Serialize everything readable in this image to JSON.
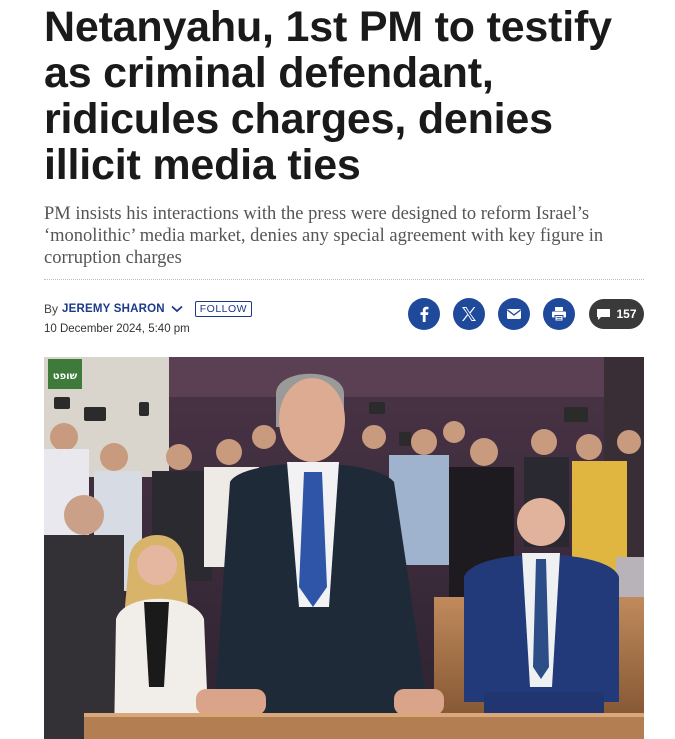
{
  "article": {
    "headline": "Netanyahu, 1st PM to testify as criminal defendant, ridicules charges, denies illicit media ties",
    "subhead": "PM insists his interactions with the press were designed to reform Israel’s ‘monolithic’ media market, denies any special agreement with key figure in corruption charges"
  },
  "byline": {
    "by": "By",
    "author": "JEREMY SHARON",
    "follow_label": "FOLLOW",
    "date": "10 December 2024, 5:40 pm"
  },
  "share": {
    "buttons": [
      {
        "name": "facebook",
        "icon": "facebook-icon",
        "color": "#1f4a9c"
      },
      {
        "name": "x",
        "icon": "x-icon",
        "color": "#1f4a9c"
      },
      {
        "name": "email",
        "icon": "email-icon",
        "color": "#1f4a9c"
      },
      {
        "name": "print",
        "icon": "print-icon",
        "color": "#1f4a9c"
      }
    ],
    "comment_count": "157"
  },
  "photo": {
    "sign_text": "שופט"
  }
}
